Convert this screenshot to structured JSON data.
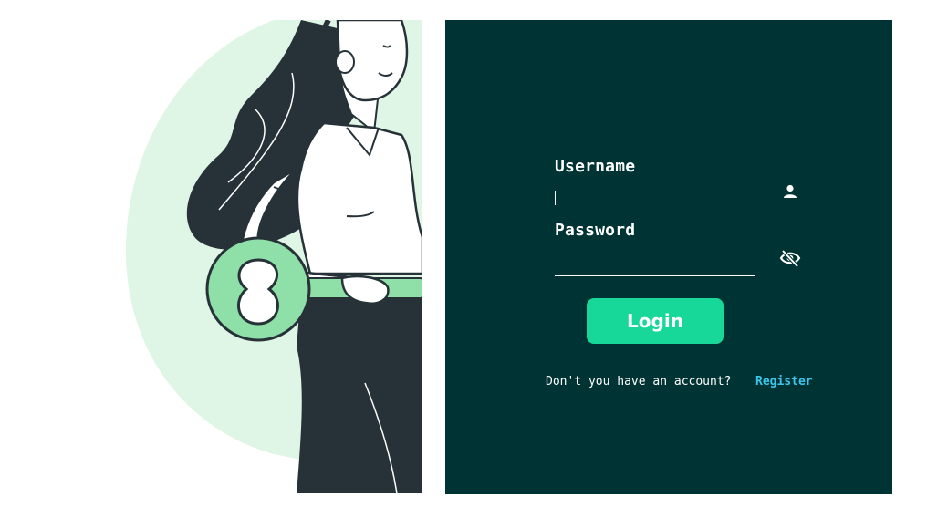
{
  "colors": {
    "panel_bg": "#003333",
    "accent": "#18d899",
    "link": "#3cc6ee",
    "illustration_bg": "#dff5e6",
    "key": "#8fe0a8",
    "dark": "#263238"
  },
  "login_form": {
    "username_label": "Username",
    "username_value": "",
    "username_icon": "user-icon",
    "password_label": "Password",
    "password_value": "",
    "password_icon": "eye-slash-icon",
    "login_button": "Login",
    "no_account_text": "Don't you have an account?",
    "register_link": "Register"
  },
  "illustration": {
    "description_icon": "woman-with-key-illustration"
  }
}
